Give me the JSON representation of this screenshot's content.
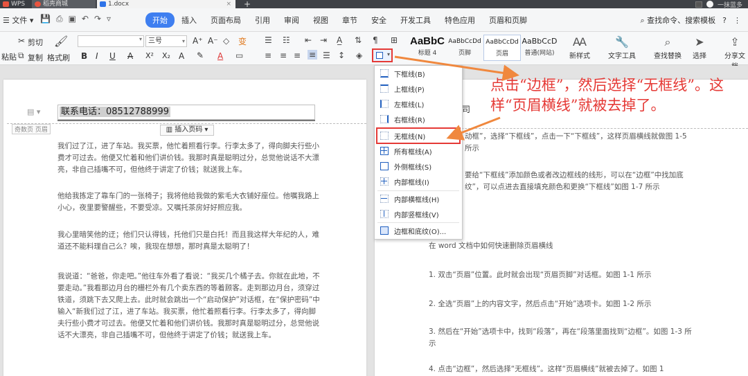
{
  "titlebar": {
    "tab_wps": "WPS",
    "tab_store": "稻壳商城",
    "tab_doc": "1.docx",
    "tab_close": "×",
    "tab_add": "+",
    "user": "一抹蓝多"
  },
  "menubar": {
    "file_label": "文件",
    "file_caret": "▾",
    "quick_icons": [
      "save-icon",
      "print-icon",
      "preview-icon",
      "undo-icon",
      "redo-icon"
    ],
    "items": [
      "开始",
      "插入",
      "页面布局",
      "引用",
      "审阅",
      "视图",
      "章节",
      "安全",
      "开发工具",
      "特色应用",
      "页眉和页脚"
    ],
    "active_index": 0,
    "search_label": "查找命令、搜索模板",
    "help": "?",
    "more": "⋮"
  },
  "ribbon": {
    "paste_label": "粘贴",
    "cut_label": "剪切",
    "copy_label": "复制",
    "format_painter_label": "格式刷",
    "font_size": "三号",
    "font_btns": [
      "B",
      "I",
      "U",
      "A",
      "X²",
      "X₂",
      "A",
      "A"
    ],
    "grow_font": "A⁺",
    "shrink_font": "A⁻",
    "styles": [
      {
        "sample": "AaBbC",
        "label": "标题 4"
      },
      {
        "sample": "AaBbCcDd",
        "label": "页脚"
      },
      {
        "sample": "AaBbCcDd",
        "label": "页眉"
      },
      {
        "sample": "AaBbCcD",
        "label": "普通(网站)"
      }
    ],
    "new_style_label": "新样式",
    "text_tool_label": "文字工具",
    "find_replace_label": "查找替换",
    "select_label": "选择",
    "share_label": "分享文档"
  },
  "left_page": {
    "header_phone": "联系电话：08512788999",
    "header_label": "奇数页 页眉",
    "insert_pagenum": "插入页码",
    "paragraphs": [
      "我们过了江，进了车站。我买票，他忙着照看行李。行李太多了，得向脚夫行些小费才可过去。他便又忙着和他们讲价钱。我那时真是聪明过分，总觉他说话不大漂亮，非自己插嘴不可，但他终于讲定了价钱；就送我上车。",
      "他给我拣定了靠车门的一张椅子；我将他给我做的紫毛大衣铺好座位。他嘱我路上小心，夜里要警醒些，不要受凉。又嘱托茶房好好照应我。",
      "我心里暗笑他的迂；他们只认得钱，托他们只是白托！而且我这样大年纪的人，难道还不能料理自己么？唉，我现在想想，那时真是太聪明了！",
      "我说道：“爸爸，你走吧。”他往车外看了看说：“我买几个橘子去。你就在此地，不要走动。”我看那边月台的栅栏外有几个卖东西的等着顾客。走到那边月台，须穿过铁道，须跳下去又爬上去。此时就会跳出一个“启动保护”对话框，在“保护密码”中输入“新我们过了江，进了车站。我买票，他忙着照看行李。行李太多了，得向脚夫行些小费才可过去。他便又忙着和他们讲价钱。我那时真是聪明过分，总觉他说话不大漂亮，非自己插嘴不可，但他终于讲定了价钱；就送我上车。"
    ]
  },
  "right_page": {
    "header_text": "称：X 公司",
    "paragraphs": [
      "动框”，选择“下框线”，点击一下“下框线”，这样页眉横线就做图 1-5 所示",
      "要给“下框线”添加颜色或者改边框线的线形，可以在“边框”中找加底纹”，可以点进去直接填充颜色和更换“下框线”如图 1-7 所示",
      "在 word 文档中如何快速删除页眉横线",
      "1. 双击“页眉”位置。此时就会出现“页眉页脚”对话框。如图 1-1 所示",
      "2. 全选“页眉”上的内容文字，然后点击“开始”选项卡。如图 1-2 所示",
      "3. 然后在“开始”选项卡中，找到“段落”，再在“段落里面找到“边框”。如图 1-3 所示",
      "4. 点击“边框”，然后选择“无框线”。这样“页眉横线”就被去掉了。如图 1"
    ]
  },
  "border_menu": {
    "items": [
      {
        "label": "下框线(B)",
        "icon": "bottom"
      },
      {
        "label": "上框线(P)",
        "icon": "top"
      },
      {
        "label": "左框线(L)",
        "icon": "left"
      },
      {
        "label": "右框线(R)",
        "icon": "right"
      },
      {
        "label": "无框线(N)",
        "icon": "none"
      },
      {
        "label": "所有框线(A)",
        "icon": "all"
      },
      {
        "label": "外侧框线(S)",
        "icon": "outer"
      },
      {
        "label": "内部框线(I)",
        "icon": "inner"
      },
      {
        "label": "内部横框线(H)",
        "icon": "innerh"
      },
      {
        "label": "内部竖框线(V)",
        "icon": "innerv"
      },
      {
        "label": "边框和底纹(O)...",
        "icon": "dlg"
      }
    ]
  },
  "annotation": {
    "text": "点击“边框”，然后选择“无框线”。这样“页眉横线”就被去掉了。",
    "color": "#e53935"
  },
  "colors": {
    "accent": "#3f7ff0",
    "highlight": "#e53935",
    "arrow": "#f0883e"
  }
}
